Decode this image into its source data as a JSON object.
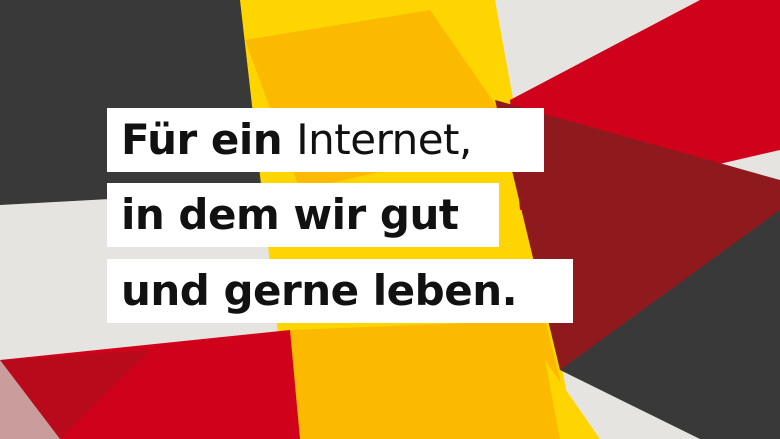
{
  "colors": {
    "black": "#3a393a",
    "gold": "#ffd500",
    "gold_dark": "#fbb900",
    "red": "#d0021b",
    "red_dark": "#8f1a1e",
    "grey": "#e6e4e0",
    "white": "#ffffff",
    "text": "#111111"
  },
  "headline": {
    "line1_bold": "Für ein",
    "line1_regular": "Internet,",
    "line2": "in dem wir gut",
    "line3": "und gerne leben."
  }
}
